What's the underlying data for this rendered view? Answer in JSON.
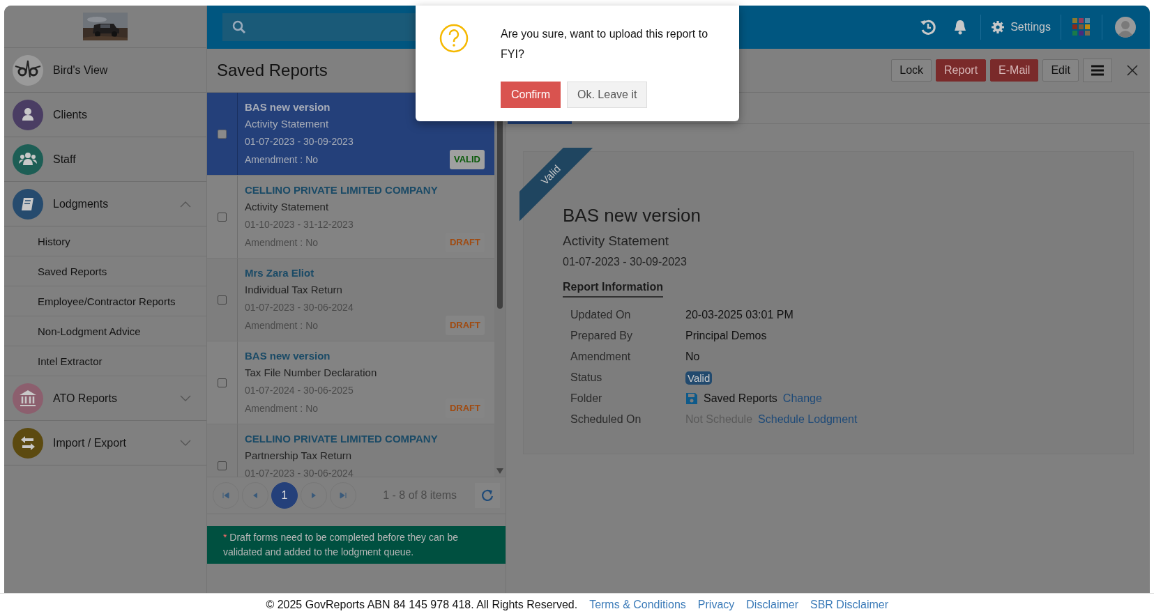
{
  "sidebar": {
    "items": [
      {
        "label": "Bird's View"
      },
      {
        "label": "Clients"
      },
      {
        "label": "Staff"
      },
      {
        "label": "Lodgments",
        "expanded": true,
        "children": [
          {
            "label": "History"
          },
          {
            "label": "Saved Reports"
          },
          {
            "label": "Employee/Contractor Reports"
          },
          {
            "label": "Non-Lodgment Advice"
          },
          {
            "label": "Intel Extractor"
          }
        ]
      },
      {
        "label": "ATO Reports",
        "expanded": false
      },
      {
        "label": "Import / Export",
        "expanded": false
      }
    ]
  },
  "topbar": {
    "settings_label": "Settings"
  },
  "header": {
    "title": "Saved Reports",
    "buttons": [
      {
        "label": "Lock",
        "kind": "default"
      },
      {
        "label": "Report",
        "kind": "danger"
      },
      {
        "label": "E-Mail",
        "kind": "danger"
      },
      {
        "label": "Edit",
        "kind": "default"
      }
    ]
  },
  "reports": [
    {
      "title": "BAS new version",
      "type": "Activity Statement",
      "period": "01-07-2023 - 30-09-2023",
      "amendment": "Amendment : No",
      "status": "VALID",
      "kind": "valid",
      "selected": true,
      "checked": false
    },
    {
      "title": "CELLINO PRIVATE LIMITED COMPANY",
      "type": "Activity Statement",
      "period": "01-10-2023 - 31-12-2023",
      "amendment": "Amendment : No",
      "status": "DRAFT",
      "kind": "draft",
      "selected": false,
      "checked": false
    },
    {
      "title": "Mrs Zara Eliot",
      "type": "Individual Tax Return",
      "period": "01-07-2023 - 30-06-2024",
      "amendment": "Amendment : No",
      "status": "DRAFT",
      "kind": "draft",
      "selected": false,
      "checked": false
    },
    {
      "title": "BAS new version",
      "type": "Tax File Number Declaration",
      "period": "01-07-2024 - 30-06-2025",
      "amendment": "Amendment : No",
      "status": "DRAFT",
      "kind": "draft",
      "selected": false,
      "checked": false
    },
    {
      "title": "CELLINO PRIVATE LIMITED COMPANY",
      "type": "Partnership Tax Return",
      "period": "01-07-2023 - 30-06-2024",
      "selected": false,
      "checked": false
    }
  ],
  "pagination": {
    "pages": [
      {
        "label": "1",
        "selected": true
      }
    ],
    "summary": "1 - 8 of 8 items"
  },
  "note": {
    "mark": "*",
    "text": "Draft forms need to be completed before they can be validated and added to the lodgment queue."
  },
  "detail": {
    "ribbon": "Valid",
    "title": "BAS new version",
    "type": "Activity Statement",
    "period": "01-07-2023 - 30-09-2023",
    "section": "Report Information",
    "rows": [
      {
        "label": "Updated On",
        "kind": "text",
        "value": "20-03-2025 03:01 PM"
      },
      {
        "label": "Prepared By",
        "kind": "text",
        "value": "Principal Demos"
      },
      {
        "label": "Amendment",
        "kind": "text",
        "value": "No"
      },
      {
        "label": "Status",
        "kind": "badge",
        "value": "Valid"
      },
      {
        "label": "Folder",
        "kind": "folder",
        "value": "Saved Reports",
        "link": "Change"
      },
      {
        "label": "Scheduled On",
        "kind": "schedule",
        "value": "Not Schedule",
        "link": "Schedule Lodgment"
      }
    ]
  },
  "dialog": {
    "message": "Are you sure, want to upload this report to FYI?",
    "buttons": [
      {
        "label": "Confirm",
        "kind": "primary"
      },
      {
        "label": "Ok. Leave it",
        "kind": "default"
      }
    ]
  },
  "footer": {
    "copyright": "© 2025 GovReports ABN 84 145 978 418. All Rights Reserved.",
    "links": [
      "Terms & Conditions",
      "Privacy",
      "Disclaimer",
      "SBR Disclaimer"
    ]
  }
}
